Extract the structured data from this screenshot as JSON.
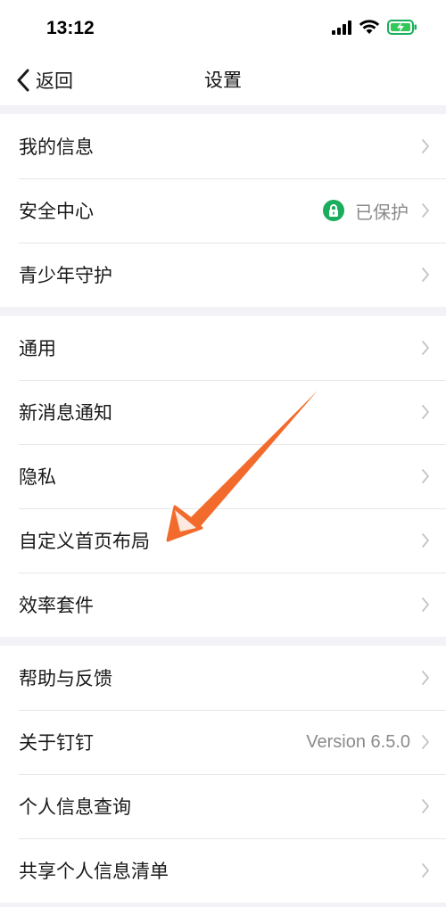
{
  "status_bar": {
    "time": "13:12"
  },
  "nav": {
    "back_label": "返回",
    "title": "设置"
  },
  "colors": {
    "accent_green": "#1aad5b",
    "annotation_orange": "#f26b2d"
  },
  "groups": [
    {
      "items": [
        {
          "label": "我的信息"
        },
        {
          "label": "安全中心",
          "status": "已保护",
          "status_icon": "lock-icon"
        },
        {
          "label": "青少年守护"
        }
      ]
    },
    {
      "items": [
        {
          "label": "通用"
        },
        {
          "label": "新消息通知"
        },
        {
          "label": "隐私"
        },
        {
          "label": "自定义首页布局"
        },
        {
          "label": "效率套件"
        }
      ]
    },
    {
      "items": [
        {
          "label": "帮助与反馈"
        },
        {
          "label": "关于钉钉",
          "value": "Version 6.5.0"
        },
        {
          "label": "个人信息查询"
        },
        {
          "label": "共享个人信息清单"
        }
      ]
    }
  ]
}
